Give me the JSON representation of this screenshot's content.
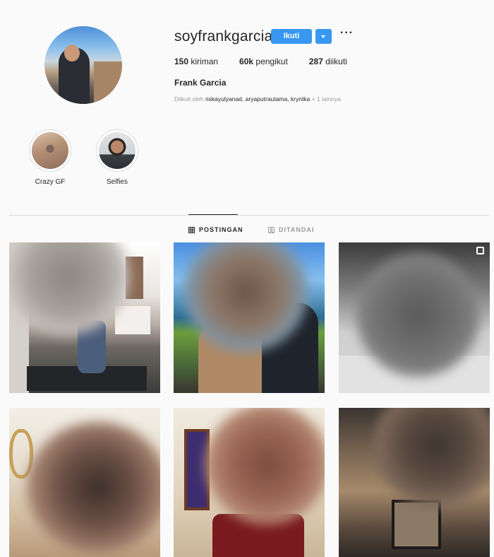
{
  "profile": {
    "username": "soyfrankgarcia",
    "follow_label": "Ikuti",
    "more_label": "···",
    "stats": [
      {
        "count": "150",
        "label": " kiriman"
      },
      {
        "count": "60k",
        "label": " pengikut"
      },
      {
        "count": "287",
        "label": " diikuti"
      }
    ],
    "full_name": "Frank Garcia",
    "followed_by_prefix": "Diikuti oleh ",
    "followed_by_names": "riskayulyanad, aryaputrautama, kryntka",
    "followed_by_suffix": " + 1 lainnya"
  },
  "highlights": [
    {
      "label": "Crazy GF"
    },
    {
      "label": "Selfies"
    }
  ],
  "tabs": [
    {
      "label": "POSTINGAN",
      "icon": "grid-icon",
      "active": true
    },
    {
      "label": "DITANDAI",
      "icon": "tag-icon",
      "active": false
    }
  ],
  "posts": [
    {
      "id": "post-1",
      "icon": null
    },
    {
      "id": "post-2",
      "icon": null
    },
    {
      "id": "post-3",
      "icon": "multiple-photos-icon"
    },
    {
      "id": "post-4",
      "icon": null
    },
    {
      "id": "post-5",
      "icon": null
    },
    {
      "id": "post-6",
      "icon": null
    }
  ],
  "colors": {
    "follow_button": "#3897f0",
    "background": "#fafafa",
    "divider": "#dbdbdb",
    "muted_text": "#999999"
  }
}
